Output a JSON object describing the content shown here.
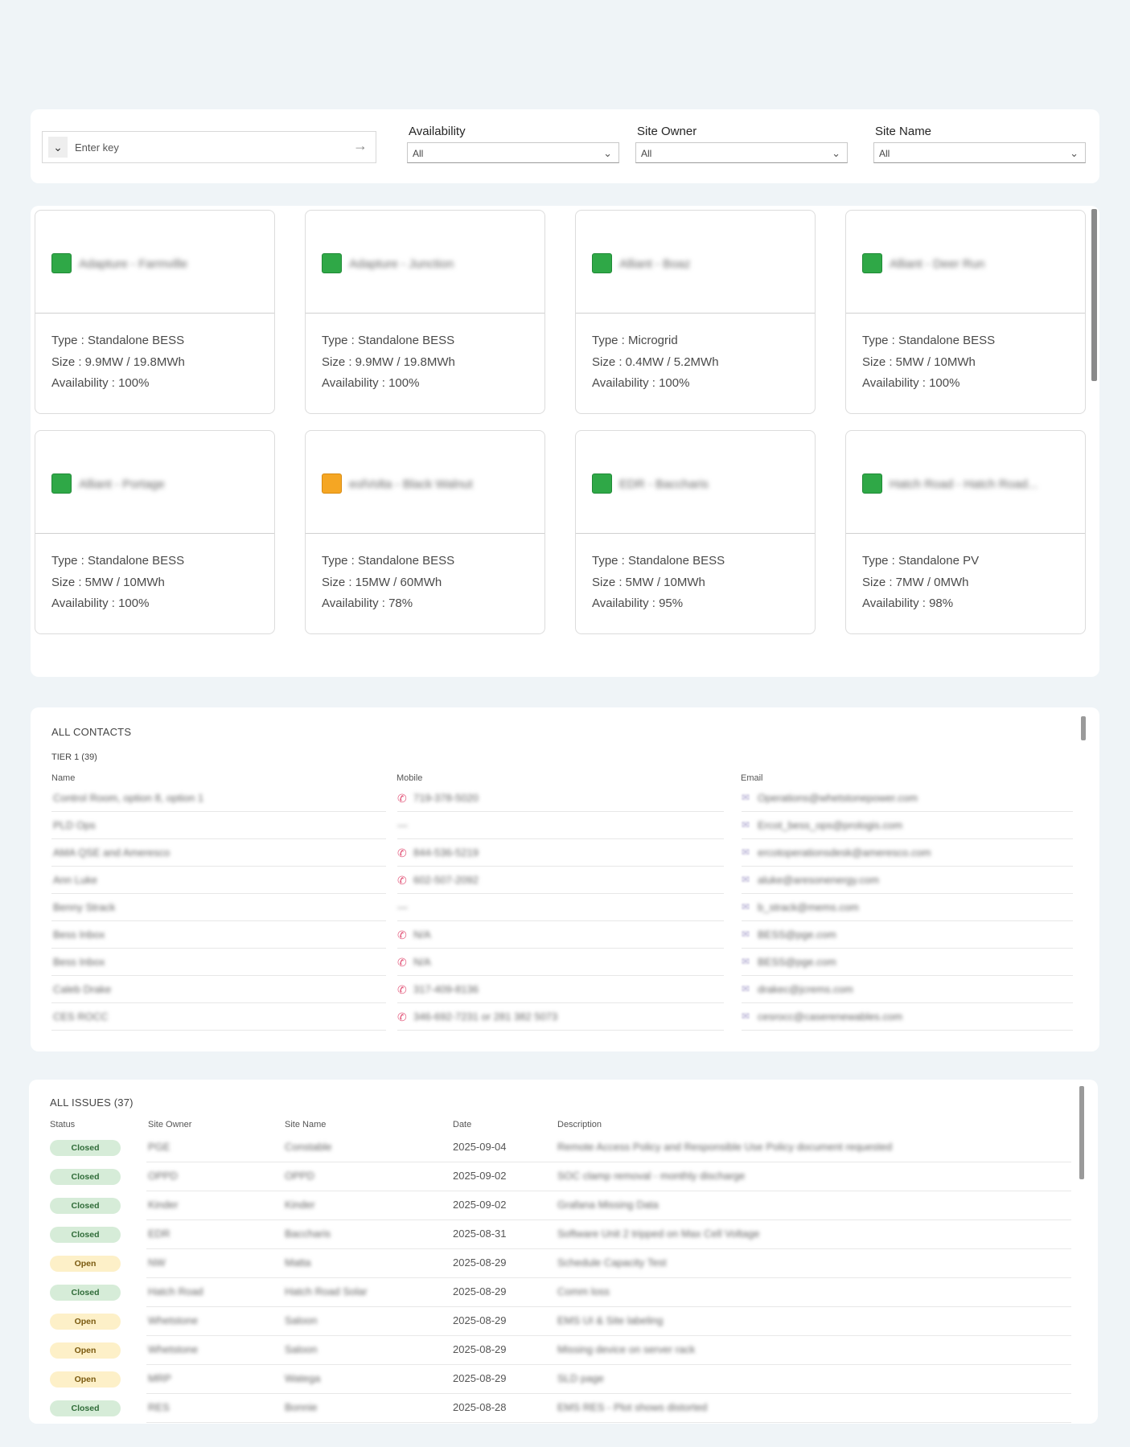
{
  "filters": {
    "search_placeholder": "Enter key",
    "availability": {
      "label": "Availability",
      "value": "All"
    },
    "site_owner": {
      "label": "Site Owner",
      "value": "All"
    },
    "site_name": {
      "label": "Site Name",
      "value": "All"
    }
  },
  "colors": {
    "status_green": "#2fa847",
    "status_orange": "#f5a623"
  },
  "sites": [
    {
      "name": "Adapture - Farmville",
      "status": "green",
      "type": "Type : Standalone BESS",
      "size": "Size : 9.9MW / 19.8MWh",
      "availability": "Availability : 100%"
    },
    {
      "name": "Adapture - Junction",
      "status": "green",
      "type": "Type : Standalone BESS",
      "size": "Size : 9.9MW / 19.8MWh",
      "availability": "Availability : 100%"
    },
    {
      "name": "Alliant - Boaz",
      "status": "green",
      "type": "Type : Microgrid",
      "size": "Size : 0.4MW / 5.2MWh",
      "availability": "Availability : 100%"
    },
    {
      "name": "Alliant - Deer Run",
      "status": "green",
      "type": "Type : Standalone BESS",
      "size": "Size : 5MW / 10MWh",
      "availability": "Availability : 100%"
    },
    {
      "name": "Alliant - Portage",
      "status": "green",
      "type": "Type : Standalone BESS",
      "size": "Size : 5MW / 10MWh",
      "availability": "Availability : 100%"
    },
    {
      "name": "eolVolta - Black Walnut",
      "status": "orange",
      "type": "Type : Standalone BESS",
      "size": "Size : 15MW / 60MWh",
      "availability": "Availability : 78%"
    },
    {
      "name": "EDR - Baccharis",
      "status": "green",
      "type": "Type : Standalone BESS",
      "size": "Size : 5MW / 10MWh",
      "availability": "Availability : 95%"
    },
    {
      "name": "Hatch Road - Hatch Road...",
      "status": "green",
      "type": "Type : Standalone PV",
      "size": "Size : 7MW / 0MWh",
      "availability": "Availability : 98%"
    }
  ],
  "contacts": {
    "title": "ALL CONTACTS",
    "tier": "TIER 1 (39)",
    "columns": {
      "name": "Name",
      "mobile": "Mobile",
      "email": "Email"
    },
    "rows": [
      {
        "name": "Control Room, option 8, option 1",
        "mobile": "719-378-5020",
        "email": "Operations@whetstonepower.com"
      },
      {
        "name": "PLD Ops",
        "mobile": "---",
        "email": "Ercot_bess_ops@prologis.com"
      },
      {
        "name": "AMA QSE and Ameresco",
        "mobile": "844-536-5219",
        "email": "ercotoperationsdesk@ameresco.com"
      },
      {
        "name": "Ann Luke",
        "mobile": "602-507-2092",
        "email": "aluke@aresonenergy.com"
      },
      {
        "name": "Benny Strack",
        "mobile": "---",
        "email": "b_strack@mems.com"
      },
      {
        "name": "Bess Inbox",
        "mobile": "N/A",
        "email": "BESS@pge.com"
      },
      {
        "name": "Bess Inbox",
        "mobile": "N/A",
        "email": "BESS@pge.com"
      },
      {
        "name": "Caleb Drake",
        "mobile": "317-409-8136",
        "email": "drakec@jcrems.com"
      },
      {
        "name": "CES ROCC",
        "mobile": "346-692-7231 or 281 382 5073",
        "email": "cesrocc@caserenewables.com"
      }
    ]
  },
  "issues": {
    "title": "ALL ISSUES (37)",
    "columns": {
      "status": "Status",
      "site_owner": "Site Owner",
      "site_name": "Site Name",
      "date": "Date",
      "description": "Description"
    },
    "rows": [
      {
        "status": "Closed",
        "owner": "PGE",
        "site": "Constable",
        "date": "2025-09-04",
        "description": "Remote Access Policy and Responsible Use Policy document requested"
      },
      {
        "status": "Closed",
        "owner": "OPPD",
        "site": "OPPD",
        "date": "2025-09-02",
        "description": "SOC clamp removal - monthly discharge"
      },
      {
        "status": "Closed",
        "owner": "Kinder",
        "site": "Kinder",
        "date": "2025-09-02",
        "description": "Grafana Missing Data"
      },
      {
        "status": "Closed",
        "owner": "EDR",
        "site": "Baccharis",
        "date": "2025-08-31",
        "description": "Software Unit 2 tripped on Max Cell Voltage"
      },
      {
        "status": "Open",
        "owner": "NW",
        "site": "Matta",
        "date": "2025-08-29",
        "description": "Schedule Capacity Test"
      },
      {
        "status": "Closed",
        "owner": "Hatch Road",
        "site": "Hatch Road Solar",
        "date": "2025-08-29",
        "description": "Comm loss"
      },
      {
        "status": "Open",
        "owner": "Whetstone",
        "site": "Saloon",
        "date": "2025-08-29",
        "description": "EMS UI & Site labeling"
      },
      {
        "status": "Open",
        "owner": "Whetstone",
        "site": "Saloon",
        "date": "2025-08-29",
        "description": "Missing device on server rack"
      },
      {
        "status": "Open",
        "owner": "MRP",
        "site": "Watega",
        "date": "2025-08-29",
        "description": "SLD page"
      },
      {
        "status": "Closed",
        "owner": "RES",
        "site": "Bonnie",
        "date": "2025-08-28",
        "description": "EMS RES - Plot shows distorted"
      }
    ]
  }
}
